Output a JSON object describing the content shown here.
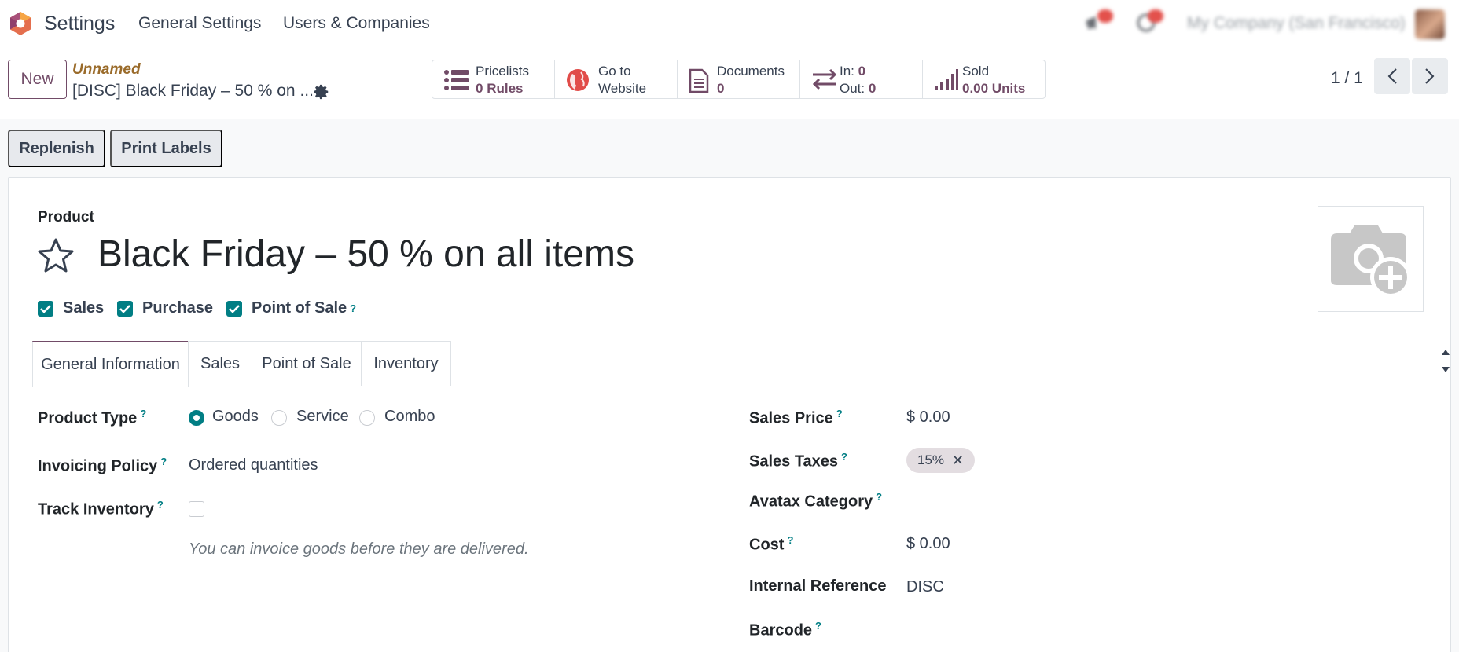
{
  "navbar": {
    "app_name": "Settings",
    "menu": [
      "General Settings",
      "Users & Companies"
    ],
    "company": "My Company (San Francisco)"
  },
  "control": {
    "new_label": "New",
    "breadcrumb_parent": "Unnamed",
    "breadcrumb_current": "[DISC] Black Friday – 50 % on ...",
    "stats": {
      "pricelists": {
        "line1": "Pricelists",
        "value": "0",
        "unit": "Rules"
      },
      "website": {
        "line1": "Go to",
        "line2": "Website"
      },
      "documents": {
        "line1": "Documents",
        "value": "0"
      },
      "moves": {
        "in_label": "In:",
        "in_value": "0",
        "out_label": "Out:",
        "out_value": "0"
      },
      "sold": {
        "line1": "Sold",
        "value": "0.00 Units"
      }
    },
    "pager": "1 / 1"
  },
  "actions": {
    "replenish": "Replenish",
    "print_labels": "Print Labels"
  },
  "form": {
    "product_label": "Product",
    "name": "Black Friday – 50 % on all items",
    "flags": {
      "sales": "Sales",
      "purchase": "Purchase",
      "pos": "Point of Sale",
      "help": "?"
    },
    "tabs": [
      "General Information",
      "Sales",
      "Point of Sale",
      "Inventory"
    ],
    "left": {
      "product_type_label": "Product Type",
      "type_options": [
        "Goods",
        "Service",
        "Combo"
      ],
      "selected_type": "Goods",
      "invoicing_policy_label": "Invoicing Policy",
      "invoicing_policy_value": "Ordered quantities",
      "track_inventory_label": "Track Inventory",
      "track_inventory_checked": false,
      "hint": "You can invoice goods before they are delivered."
    },
    "right": {
      "sales_price_label": "Sales Price",
      "sales_price_value": "$ 0.00",
      "sales_taxes_label": "Sales Taxes",
      "sales_taxes_tag": "15%",
      "avatax_label": "Avatax Category",
      "cost_label": "Cost",
      "cost_value": "$ 0.00",
      "internal_ref_label": "Internal Reference",
      "internal_ref_value": "DISC",
      "barcode_label": "Barcode"
    }
  },
  "colors": {
    "brand": "#714b67",
    "accent": "#017e84"
  }
}
